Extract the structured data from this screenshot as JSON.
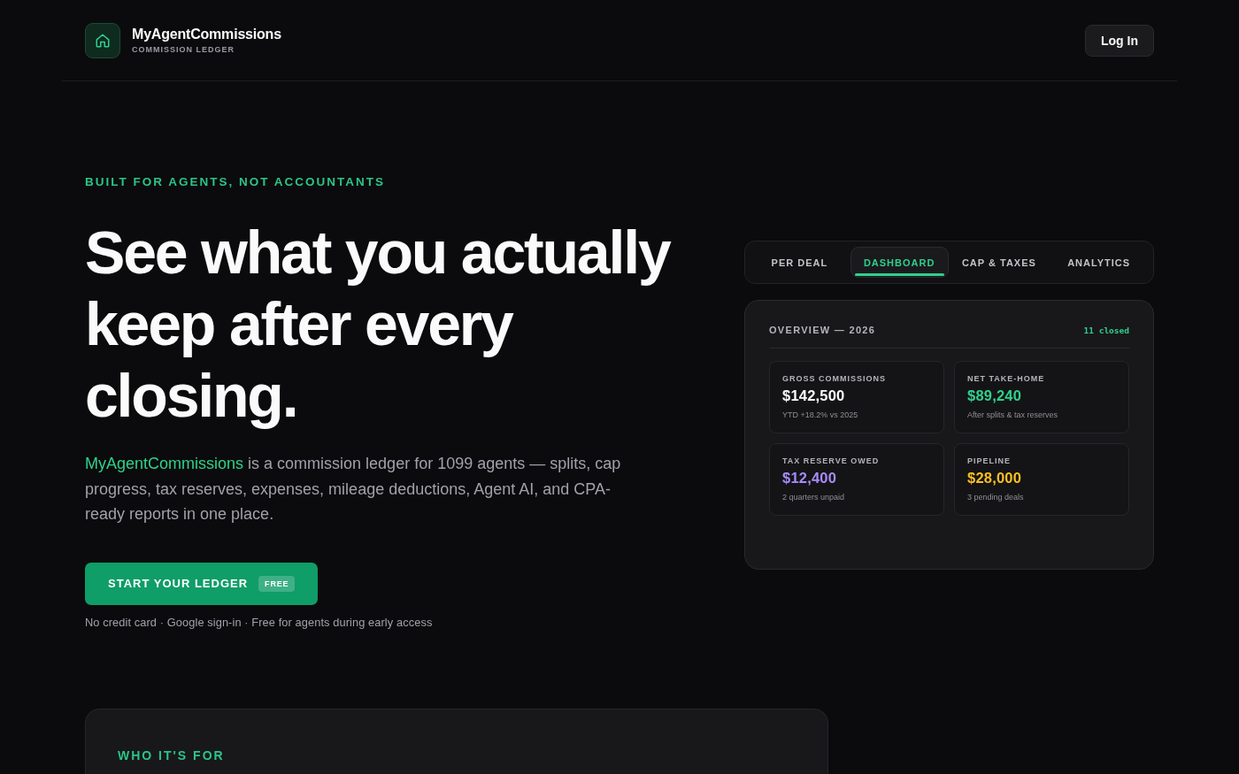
{
  "header": {
    "brand": {
      "name": "MyAgentCommissions",
      "tagline": "COMMISSION LEDGER"
    },
    "login_button": "Log In"
  },
  "hero": {
    "eyebrow": "BUILT FOR AGENTS, NOT ACCOUNTANTS",
    "headline": "See what you actually keep after every closing.",
    "description": "**MyAgentCommissions** is a commission ledger for 1099 agents — splits, cap progress, tax reserves, expenses, mileage deductions, Agent AI, and CPA-ready reports in one place.",
    "cta": {
      "label": "START YOUR LEDGER",
      "badge": "FREE"
    },
    "note": "No credit card · Google sign-in · Free for agents during early access"
  },
  "preview": {
    "tabs": [
      {
        "label": "PER DEAL",
        "selected": false
      },
      {
        "label": "DASHBOARD",
        "selected": true
      },
      {
        "label": "CAP & TAXES",
        "selected": false
      },
      {
        "label": "ANALYTICS",
        "selected": false
      }
    ],
    "overview": {
      "title": "OVERVIEW — 2026",
      "count": "11 closed",
      "stats": [
        {
          "label": "GROSS COMMISSIONS",
          "value": "$142,500",
          "sub": "YTD +18.2% vs 2025",
          "color": "#fafafa"
        },
        {
          "label": "NET TAKE-HOME",
          "value": "$89,240",
          "sub": "After splits & tax reserves",
          "color": "#2fd08c"
        },
        {
          "label": "TAX RESERVE OWED",
          "value": "$12,400",
          "sub": "2 quarters unpaid",
          "color": "#a78bfa"
        },
        {
          "label": "PIPELINE",
          "value": "$28,000",
          "sub": "3 pending deals",
          "color": "#fbbf24"
        }
      ]
    }
  },
  "audience_section": {
    "eyebrow": "WHO IT'S FOR"
  }
}
